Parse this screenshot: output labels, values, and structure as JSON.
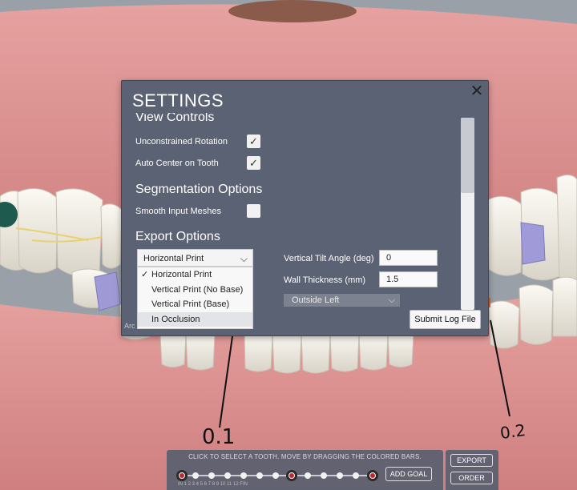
{
  "settings": {
    "title": "SETTINGS",
    "close_icon": "close-icon",
    "view_controls": {
      "heading": "View Controls",
      "unconstrained_rotation": {
        "label": "Unconstrained Rotation",
        "checked": true
      },
      "auto_center_on_tooth": {
        "label": "Auto Center on Tooth",
        "checked": true
      }
    },
    "segmentation_options": {
      "heading": "Segmentation Options",
      "smooth_input_meshes": {
        "label": "Smooth Input Meshes",
        "checked": false
      }
    },
    "export_options": {
      "heading": "Export Options",
      "selected": "Horizontal Print",
      "options": [
        "Horizontal Print",
        "Vertical Print (No Base)",
        "Vertical Print (Base)",
        "In Occlusion"
      ],
      "highlighted": "In Occlusion",
      "vertical_tilt_angle": {
        "label": "Vertical Tilt Angle (deg)",
        "value": "0"
      },
      "wall_thickness": {
        "label": "Wall Thickness (mm)",
        "value": "1.5"
      },
      "position": "Outside Left"
    },
    "cutoff_text": "Arc",
    "submit_log_label": "Submit Log File"
  },
  "measurements": {
    "left": "0.1",
    "right": "0.2"
  },
  "goal_bar": {
    "hint": "CLICK TO SELECT A TOOTH. MOVE BY DRAGGING THE COLORED BARS.",
    "tick_labels": "IN  1  2  3  4  5  6  7  8  9  10  11  12 FIN",
    "add_goal_label": "ADD GOAL"
  },
  "actions": {
    "export_label": "EXPORT",
    "order_label": "ORDER"
  },
  "colors": {
    "dialog_bg": "#5b6273",
    "gum": "#d98b8b",
    "tooth": "#f1eee6",
    "key_step": "#c0262f"
  }
}
